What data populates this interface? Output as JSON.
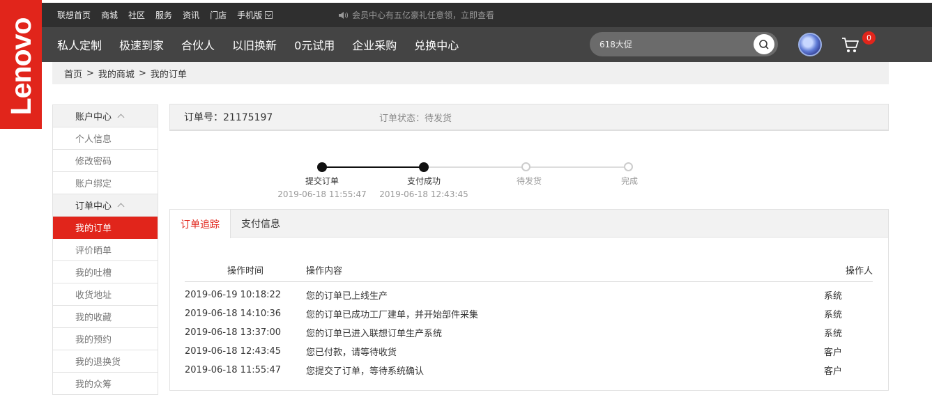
{
  "logo": {
    "text": "Lenovo"
  },
  "topbar": {
    "links": [
      "联想首页",
      "商城",
      "社区",
      "服务",
      "资讯",
      "门店",
      "手机版"
    ],
    "notice": "会员中心有五亿豪礼任意领，立即查看"
  },
  "nav": {
    "items": [
      "私人定制",
      "极速到家",
      "合伙人",
      "以旧换新",
      "0元试用",
      "企业采购",
      "兑换中心"
    ],
    "search_placeholder": "618大促",
    "cart_count": "0"
  },
  "breadcrumb": [
    "首页",
    "我的商城",
    "我的订单"
  ],
  "breadcrumb_sep": ">",
  "sidebar": {
    "account_header": "账户中心",
    "account_items": [
      "个人信息",
      "修改密码",
      "账户绑定"
    ],
    "order_header": "订单中心",
    "order_items": [
      "我的订单",
      "评价晒单",
      "我的吐槽",
      "收货地址",
      "我的收藏",
      "我的预约",
      "我的退换货",
      "我的众筹"
    ],
    "active": "我的订单"
  },
  "order": {
    "number_label": "订单号：21175197",
    "status_label": "订单状态：待发货"
  },
  "progress": {
    "steps": [
      {
        "label": "提交订单",
        "time": "2019-06-18 11:55:47",
        "done": true
      },
      {
        "label": "支付成功",
        "time": "2019-06-18 12:43:45",
        "done": true
      },
      {
        "label": "待发货",
        "time": "",
        "done": false
      },
      {
        "label": "完成",
        "time": "",
        "done": false
      }
    ]
  },
  "tabs": [
    "订单追踪",
    "支付信息"
  ],
  "tracking": {
    "headers": {
      "time": "操作时间",
      "content": "操作内容",
      "operator": "操作人"
    },
    "rows": [
      {
        "time": "2019-06-19 10:18:22",
        "content": "您的订单已上线生产",
        "operator": "系统"
      },
      {
        "time": "2019-06-18 14:10:36",
        "content": "您的订单已成功工厂建单，并开始部件采集",
        "operator": "系统"
      },
      {
        "time": "2019-06-18 13:37:00",
        "content": "您的订单已进入联想订单生产系统",
        "operator": "系统"
      },
      {
        "time": "2019-06-18 12:43:45",
        "content": "您已付款，请等待收货",
        "operator": "客户"
      },
      {
        "time": "2019-06-18 11:55:47",
        "content": "您提交了订单，等待系统确认",
        "operator": "客户"
      }
    ]
  },
  "colors": {
    "brand_red": "#e1251b",
    "topbar": "#2f2f2f",
    "navbar": "#444444"
  }
}
